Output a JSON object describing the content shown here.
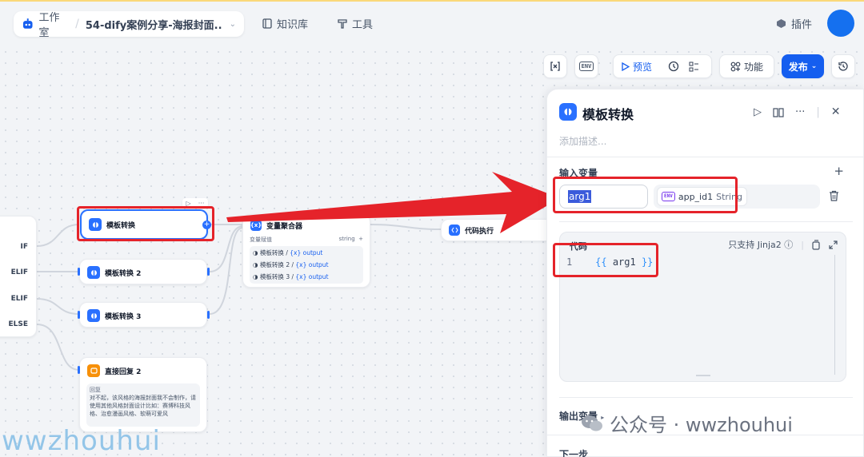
{
  "header": {
    "studio_label": "工作室",
    "app_name": "54-dify案例分享-海报封面...",
    "nav_knowledge": "知识库",
    "nav_tools": "工具",
    "plugins": "插件"
  },
  "toolbar": {
    "env_label": "ENV",
    "preview": "预览",
    "features": "功能",
    "publish": "发布"
  },
  "nodes": {
    "if_branches": [
      "IF",
      "ELIF",
      "ELIF",
      "ELSE"
    ],
    "template1": "模板转换",
    "template2": "模板转换 2",
    "template3": "模板转换 3",
    "aggregator": {
      "title": "变量聚合器",
      "sub_label": "变量赋值",
      "type": "string",
      "rows": [
        {
          "node": "模板转换",
          "var": "output"
        },
        {
          "node": "模板转换 2",
          "var": "output"
        },
        {
          "node": "模板转换 3",
          "var": "output"
        }
      ],
      "var_prefix": "{x}"
    },
    "code": "代码执行",
    "reply": {
      "title": "直接回复 2",
      "label": "回复",
      "text": "对不起，该风格的海报封面我不会制作，请使用其他风格封面设计比如：赛博科技风格、治愈漫画风格、软萌可爱风"
    }
  },
  "panel": {
    "title": "模板转换",
    "description_placeholder": "添加描述...",
    "input_section": "输入变量",
    "var_name": "arg1",
    "var_source": "app_id1",
    "var_type": "String",
    "code_section": "代码",
    "jinja_support": "只支持 Jinja2",
    "code_line_number": "1",
    "code_open": "{{",
    "code_var": " arg1 ",
    "code_close": "}}",
    "output_section": "输出变量",
    "next_section": "下一步"
  },
  "watermarks": {
    "left": "wwzhouhui",
    "right": "公众号 · wwzhouhui"
  },
  "colors": {
    "accent": "#155eef",
    "annotation_red": "#e5232a",
    "node_blue": "#2970ff"
  }
}
